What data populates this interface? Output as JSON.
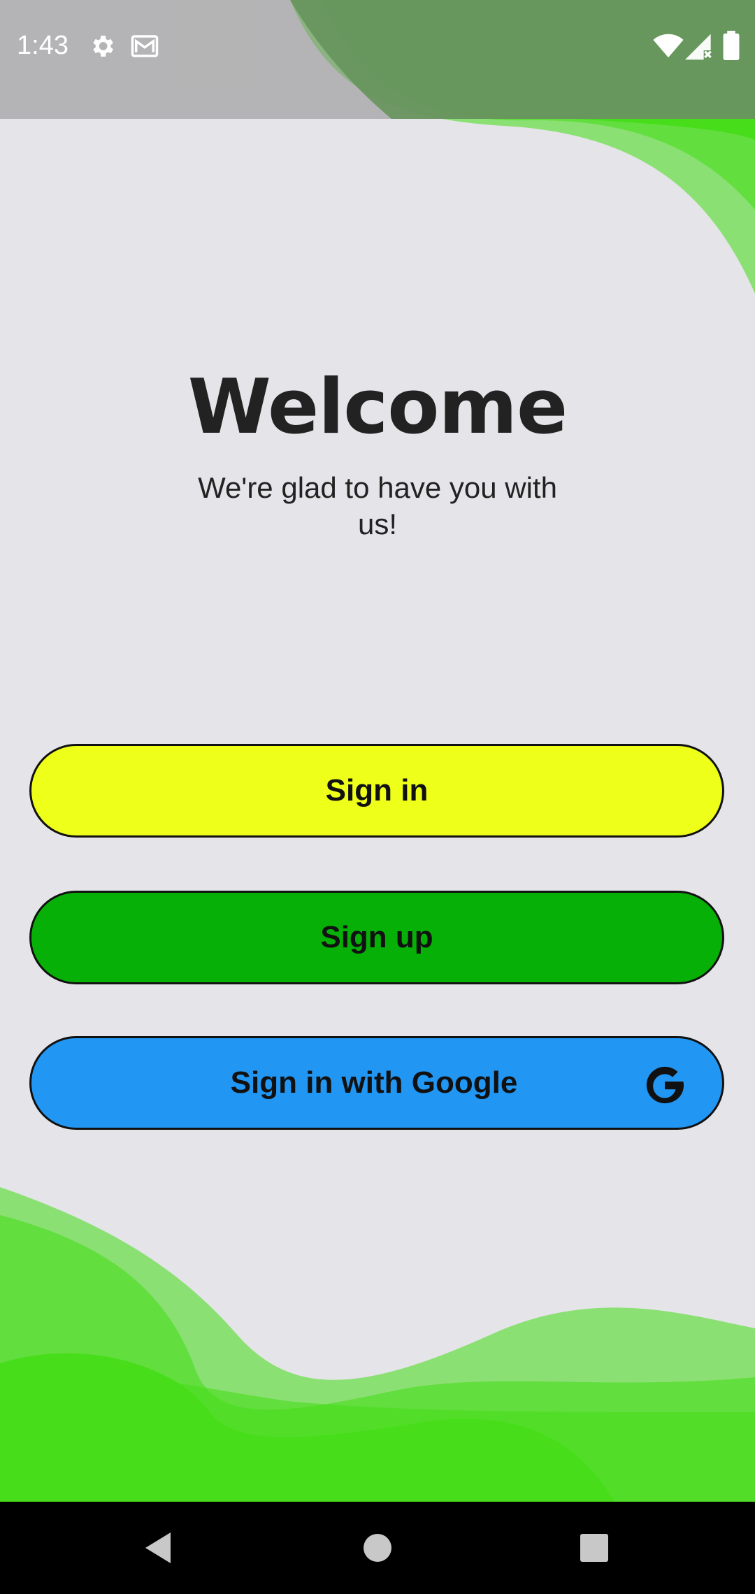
{
  "status_bar": {
    "time": "1:43",
    "icons": [
      "settings-icon",
      "gmail-icon",
      "wifi-icon",
      "signal-icon",
      "battery-icon"
    ]
  },
  "main": {
    "title": "Welcome",
    "subtitle": "We're glad to have you with us!"
  },
  "buttons": {
    "sign_in": "Sign in",
    "sign_up": "Sign up",
    "google": "Sign in with Google"
  },
  "nav_bar": {
    "icons": [
      "back-icon",
      "home-icon",
      "recents-icon"
    ]
  },
  "colors": {
    "background": "#e5e4e8",
    "sign_in_button": "#eeff1a",
    "sign_up_button": "#07b007",
    "google_button": "#2196f3",
    "wave_dark": "#3a9d23",
    "wave_mid": "#47dd1a",
    "wave_light": "#8be073"
  }
}
